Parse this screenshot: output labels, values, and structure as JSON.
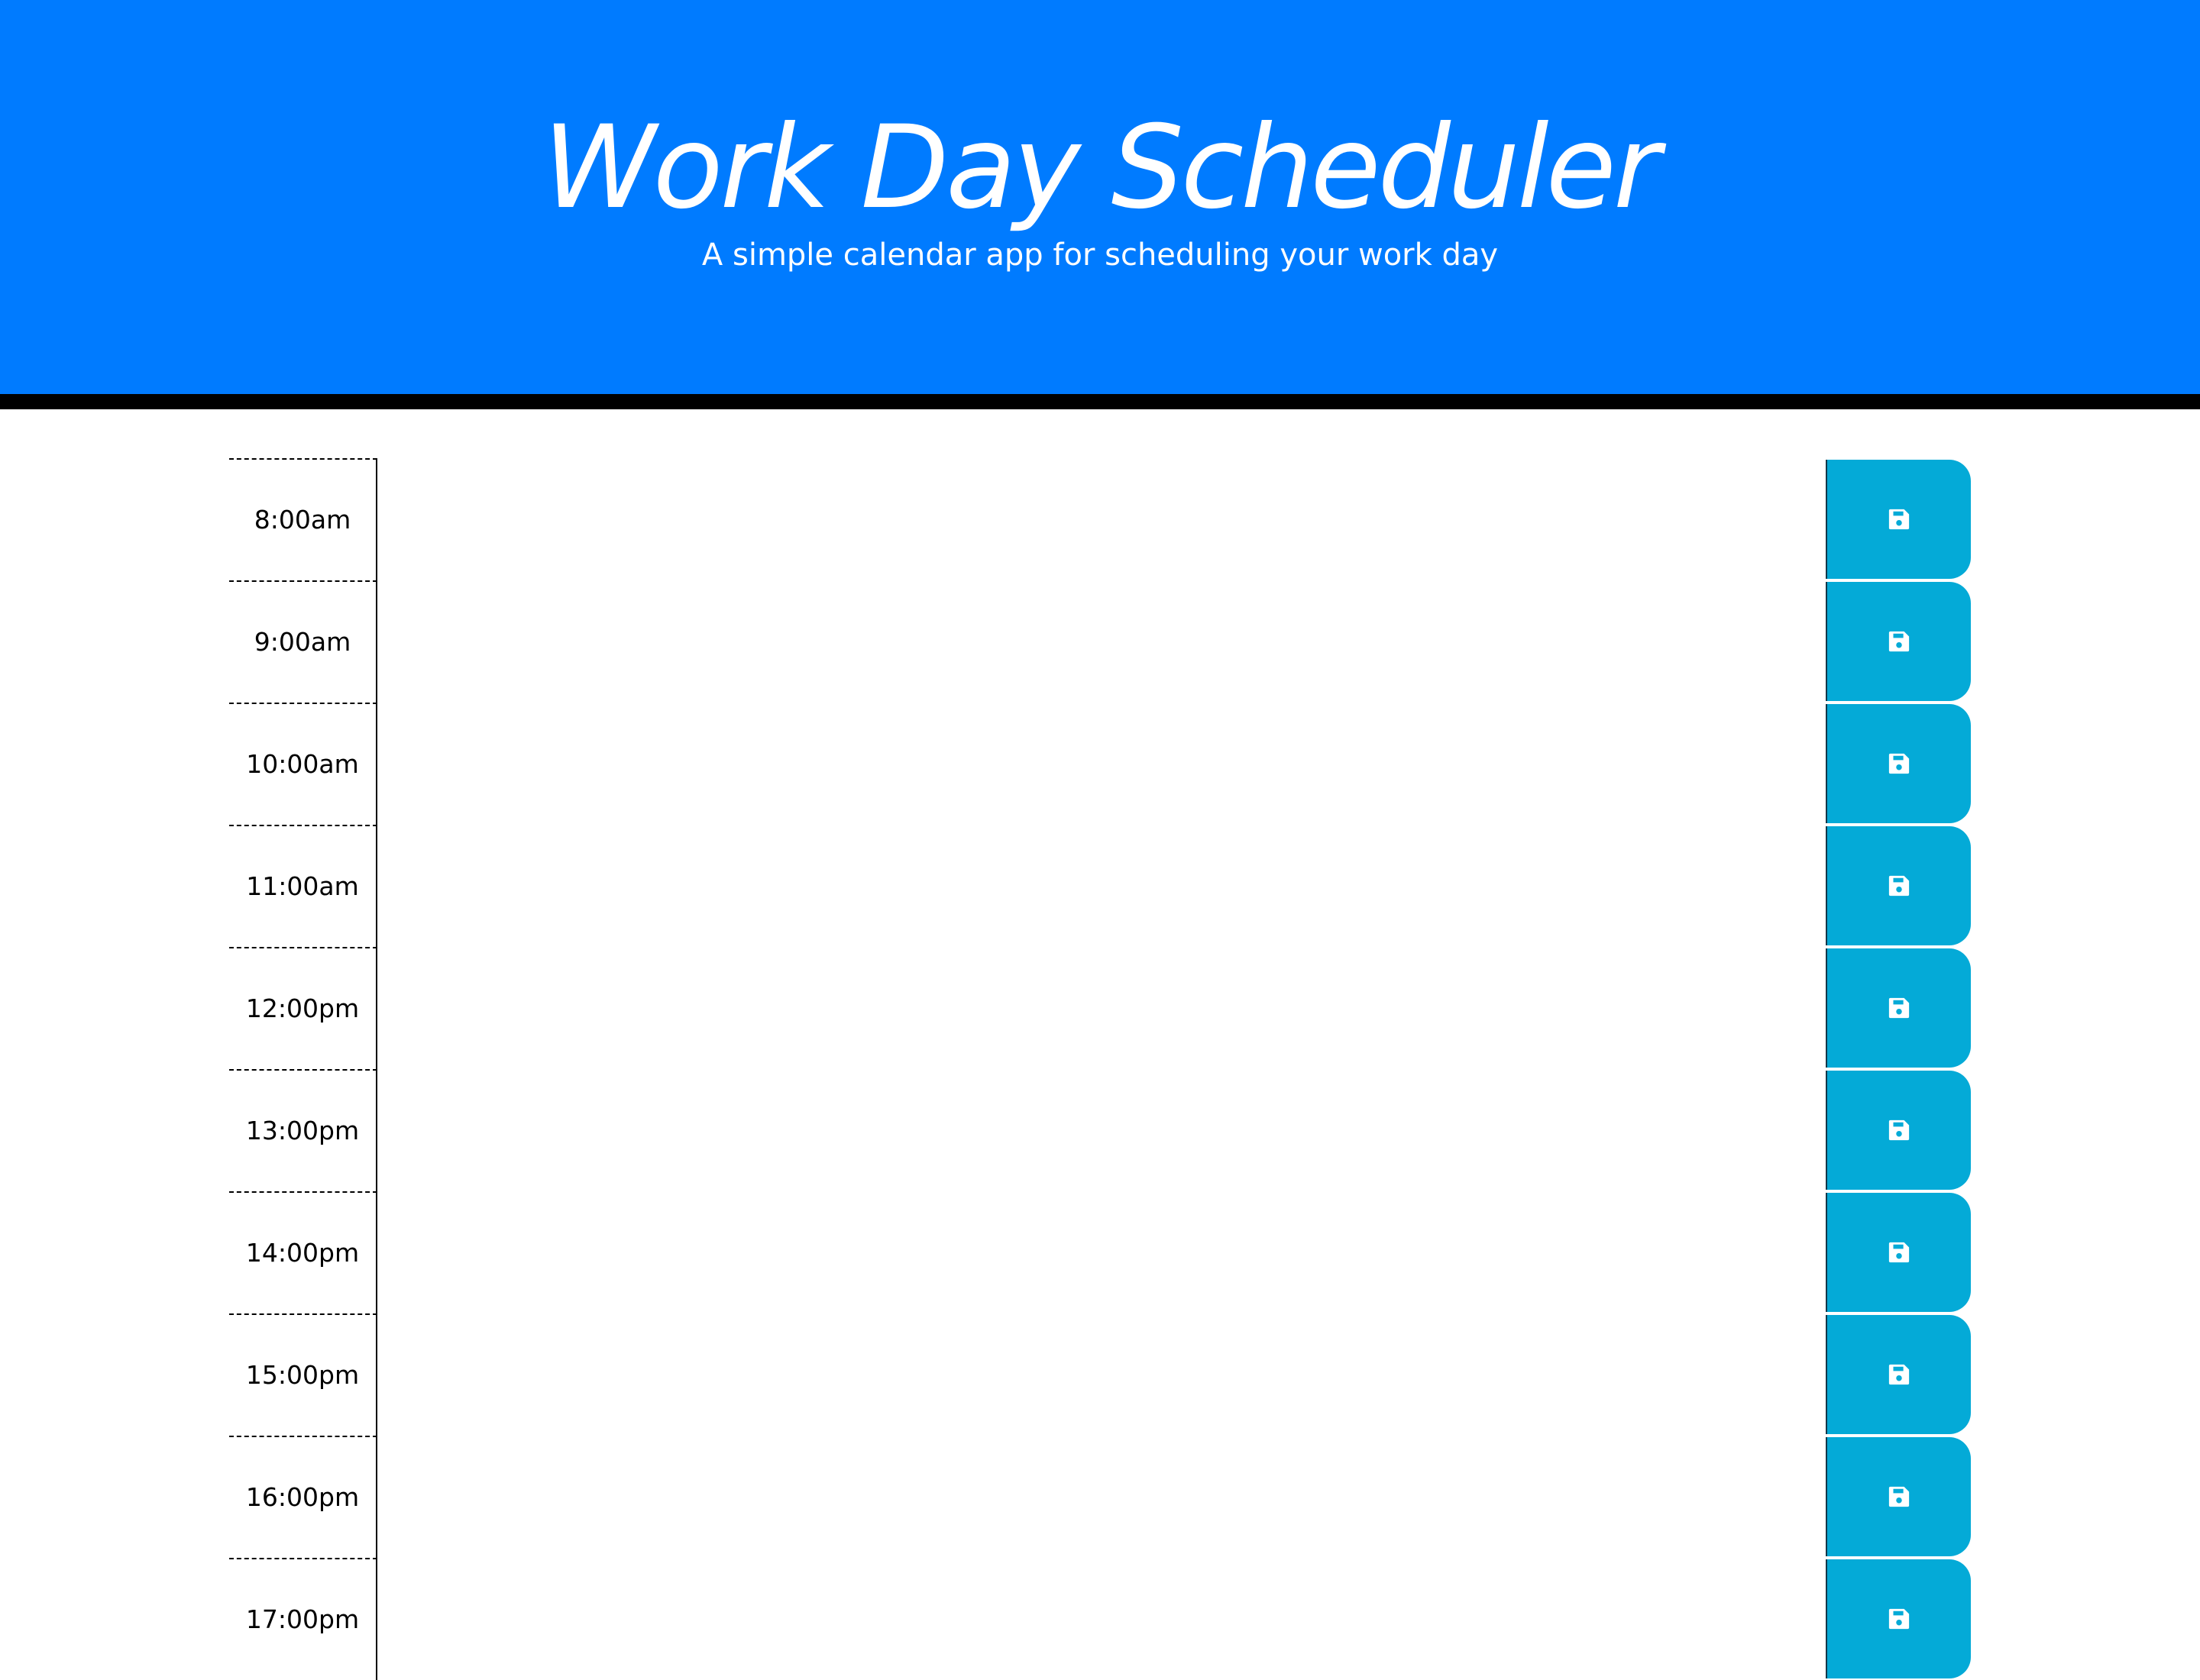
{
  "header": {
    "title": "Work Day Scheduler",
    "subtitle": "A simple calendar app for scheduling your work day"
  },
  "colors": {
    "header_background": "#007bff",
    "save_button": "#04aad7"
  },
  "time_blocks": [
    {
      "hour": "8:00am",
      "description": "",
      "save_icon": "floppy-disk-icon"
    },
    {
      "hour": "9:00am",
      "description": "",
      "save_icon": "floppy-disk-icon"
    },
    {
      "hour": "10:00am",
      "description": "",
      "save_icon": "floppy-disk-icon"
    },
    {
      "hour": "11:00am",
      "description": "",
      "save_icon": "floppy-disk-icon"
    },
    {
      "hour": "12:00pm",
      "description": "",
      "save_icon": "floppy-disk-icon"
    },
    {
      "hour": "13:00pm",
      "description": "",
      "save_icon": "floppy-disk-icon"
    },
    {
      "hour": "14:00pm",
      "description": "",
      "save_icon": "floppy-disk-icon"
    },
    {
      "hour": "15:00pm",
      "description": "",
      "save_icon": "floppy-disk-icon"
    },
    {
      "hour": "16:00pm",
      "description": "",
      "save_icon": "floppy-disk-icon"
    },
    {
      "hour": "17:00pm",
      "description": "",
      "save_icon": "floppy-disk-icon"
    }
  ]
}
